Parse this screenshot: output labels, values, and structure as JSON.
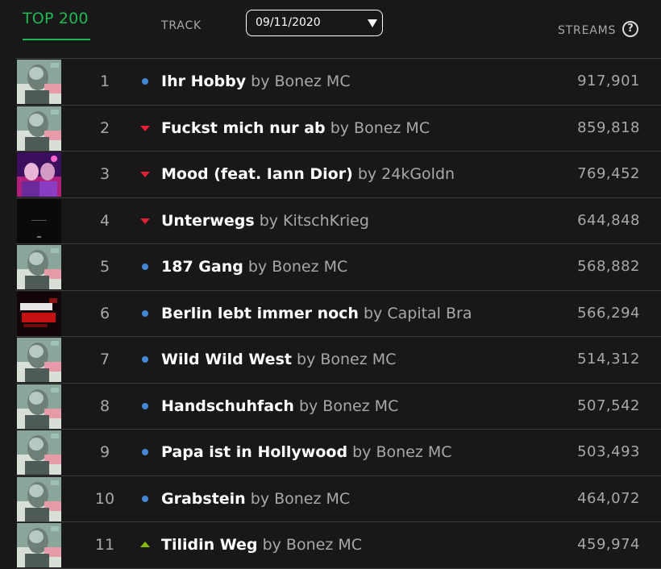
{
  "header": {
    "tab_top200": "TOP 200",
    "col_track": "TRACK",
    "date_value": "09/11/2020",
    "col_streams": "STREAMS",
    "help_glyph": "?"
  },
  "colors": {
    "accent_green": "#1db954",
    "trend_same": "#4687d6",
    "trend_down": "#e22134",
    "trend_up": "#84bd00"
  },
  "rows": [
    {
      "rank": "1",
      "trend": "same",
      "title": "Ihr Hobby",
      "artist_text": "by Bonez MC",
      "streams": "917,901",
      "art": "bonez"
    },
    {
      "rank": "2",
      "trend": "down",
      "title": "Fuckst mich nur ab",
      "artist_text": "by Bonez MC",
      "streams": "859,818",
      "art": "bonez"
    },
    {
      "rank": "3",
      "trend": "down",
      "title": "Mood (feat. Iann Dior)",
      "artist_text": "by 24kGoldn",
      "streams": "769,452",
      "art": "mood"
    },
    {
      "rank": "4",
      "trend": "down",
      "title": "Unterwegs",
      "artist_text": "by KitschKrieg",
      "streams": "644,848",
      "art": "dark"
    },
    {
      "rank": "5",
      "trend": "same",
      "title": "187 Gang",
      "artist_text": "by Bonez MC",
      "streams": "568,882",
      "art": "bonez"
    },
    {
      "rank": "6",
      "trend": "same",
      "title": "Berlin lebt immer noch",
      "artist_text": "by Capital Bra",
      "streams": "566,294",
      "art": "berlin"
    },
    {
      "rank": "7",
      "trend": "same",
      "title": "Wild Wild West",
      "artist_text": "by Bonez MC",
      "streams": "514,312",
      "art": "bonez"
    },
    {
      "rank": "8",
      "trend": "same",
      "title": "Handschuhfach",
      "artist_text": "by Bonez MC",
      "streams": "507,542",
      "art": "bonez"
    },
    {
      "rank": "9",
      "trend": "same",
      "title": "Papa ist in Hollywood",
      "artist_text": "by Bonez MC",
      "streams": "503,493",
      "art": "bonez"
    },
    {
      "rank": "10",
      "trend": "same",
      "title": "Grabstein",
      "artist_text": "by Bonez MC",
      "streams": "464,072",
      "art": "bonez"
    },
    {
      "rank": "11",
      "trend": "up",
      "title": "Tilidin Weg",
      "artist_text": "by Bonez MC",
      "streams": "459,974",
      "art": "bonez"
    }
  ]
}
